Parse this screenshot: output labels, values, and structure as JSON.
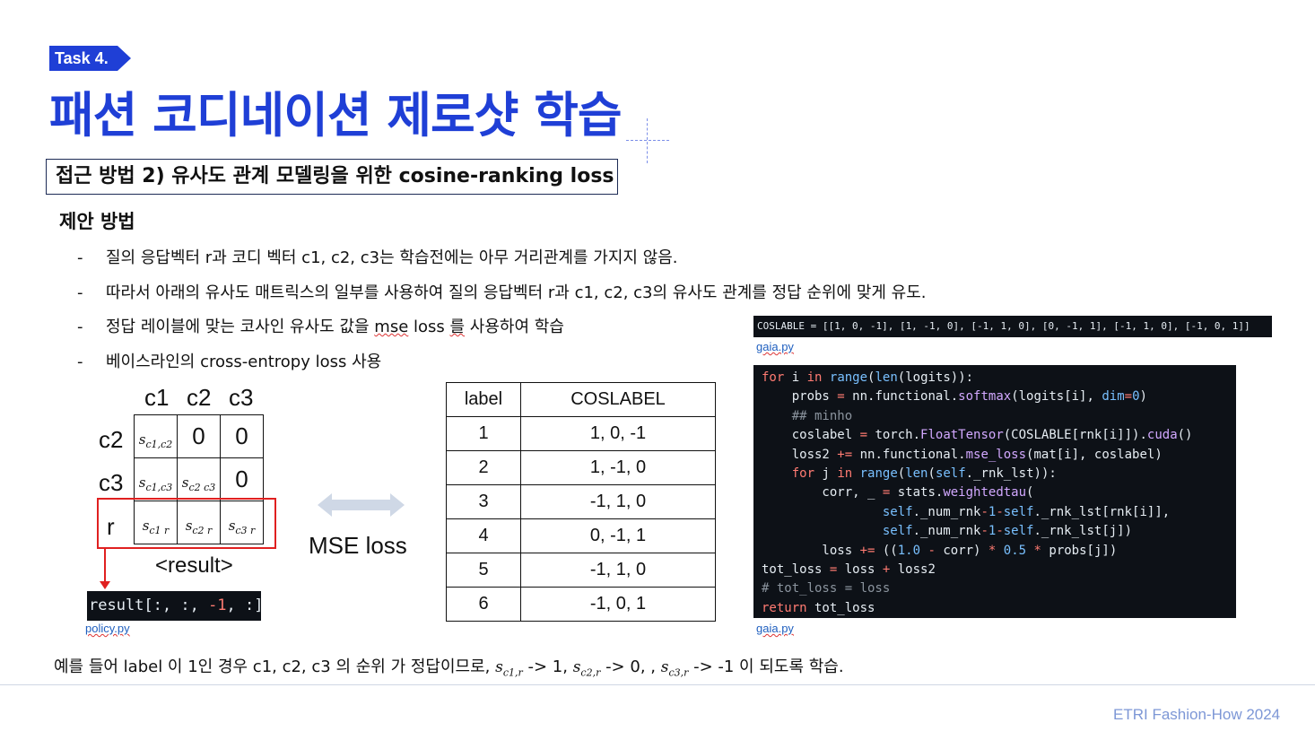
{
  "task_tag": "Task 4.",
  "title": "패션 코디네이션 제로샷 학습",
  "approach": "접근 방법 2) 유사도 관계 모델링을 위한 cosine-ranking loss",
  "section_head": "제안 방법",
  "bullets": [
    "질의 응답벡터 r과 코디 벡터 c1, c2, c3는 학습전에는 아무 거리관계를 가지지 않음.",
    "따라서 아래의 유사도 매트릭스의 일부를 사용하여 질의 응답벡터 r과 c1, c2, c3의 유사도 관계를 정답 순위에 맞게 유도.",
    "정답 레이블에 맞는 코사인 유사도 값을 mse loss 를 사용하여 학습",
    "베이스라인의 cross-entropy loss 사용"
  ],
  "bullet3_parts": {
    "a": "정답 레이블에 맞는 코사인 유사도 값을 ",
    "b": "mse",
    "c": " loss ",
    "d": "를",
    "e": " 사용하여 학습"
  },
  "dash": "-",
  "matrix": {
    "col_headers": [
      "c1",
      "c2",
      "c3"
    ],
    "row_headers": [
      "c2",
      "c3",
      "r"
    ],
    "cells": {
      "r0c1": "0",
      "r0c2": "0",
      "r1c2": "0",
      "s_c1c2": "c1,c2",
      "s_c1c3": "c1,c3",
      "s_c2c3": "c2 c3",
      "s_c1r": "c1 r",
      "s_c2r": "c2 r",
      "s_c3r": "c3 r",
      "s": "s"
    },
    "result_label": "<result>",
    "result_code": {
      "a": "result[:, :, ",
      "b": "-1",
      "c": ", :]"
    },
    "result_file": "policy.py"
  },
  "mse_label": "MSE loss",
  "label_table": {
    "headers": [
      "label",
      "COSLABEL"
    ],
    "rows": [
      [
        "1",
        "1, 0, -1"
      ],
      [
        "2",
        "1, -1, 0"
      ],
      [
        "3",
        "-1, 1, 0"
      ],
      [
        "4",
        "0, -1, 1"
      ],
      [
        "5",
        "-1, 1, 0"
      ],
      [
        "6",
        "-1, 0, 1"
      ]
    ]
  },
  "coslabel_code": "COSLABLE = [[1, 0, -1], [1, -1, 0], [-1, 1, 0], [0, -1, 1], [-1, 1, 0], [-1, 0, 1]]",
  "coslabel_file": "gaia.py",
  "code_file": "gaia.py",
  "bottom_text": {
    "a": "예를 들어 label 이 1인 경우 c1, c2, c3 의 순위 가 정답이므로, ",
    "s": "s",
    "sub1": "c1,r",
    "b": " -> 1, ",
    "sub2": "c2,r",
    "c": " -> 0, , ",
    "sub3": "c3,r",
    "d": " -> -1  이 되도록 학습."
  },
  "footer": "ETRI Fashion-How 2024",
  "colors": {
    "brand": "#1f3fd6",
    "red": "#e02020",
    "code_bg": "#0d1117",
    "footer": "#7d97d6"
  }
}
